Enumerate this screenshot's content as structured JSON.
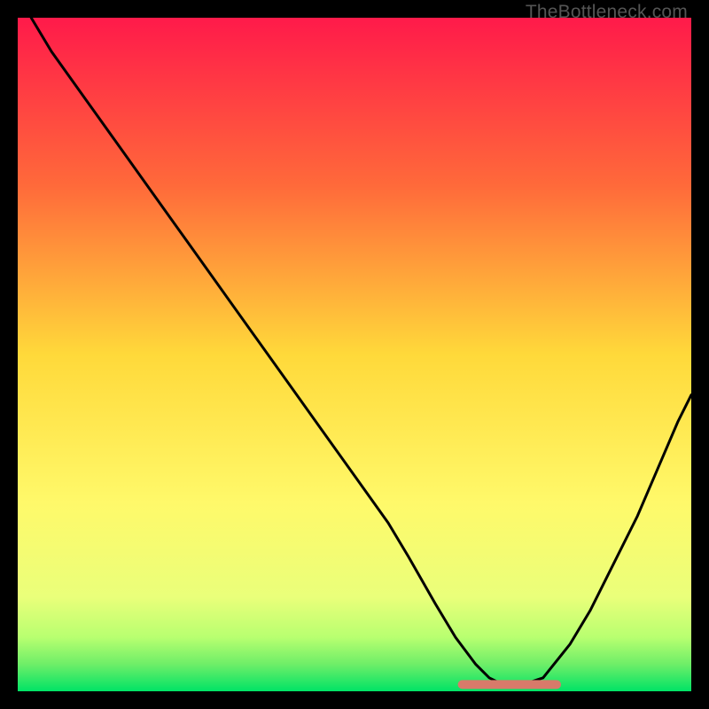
{
  "watermark": "TheBottleneck.com",
  "colors": {
    "gradient_top": "#ff1a4a",
    "gradient_mid_upper": "#ff7a3a",
    "gradient_mid": "#ffd93a",
    "gradient_lower": "#fff96a",
    "gradient_near_bottom": "#c8ff6a",
    "gradient_bottom": "#00e366",
    "curve": "#000000",
    "accent_segment": "#d87a6a",
    "frame": "#000000"
  },
  "chart_data": {
    "type": "line",
    "title": "",
    "xlabel": "",
    "ylabel": "",
    "xlim": [
      0,
      100
    ],
    "ylim": [
      0,
      100
    ],
    "series": [
      {
        "name": "bottleneck-curve",
        "x": [
          2,
          5,
          10,
          15,
          20,
          25,
          30,
          35,
          40,
          45,
          50,
          55,
          58,
          62,
          65,
          68,
          70,
          72,
          75,
          78,
          82,
          85,
          88,
          92,
          95,
          98,
          100
        ],
        "values": [
          100,
          95,
          88,
          81,
          74,
          67,
          60,
          53,
          46,
          39,
          32,
          25,
          20,
          13,
          8,
          4,
          2,
          1,
          1,
          2,
          7,
          12,
          18,
          26,
          33,
          40,
          44
        ]
      }
    ],
    "accent_segment": {
      "name": "optimal-band",
      "x_start": 66,
      "x_end": 80,
      "y": 1
    },
    "gradient_stops": [
      {
        "pos": 0.0,
        "color": "#ff1a4a"
      },
      {
        "pos": 0.25,
        "color": "#ff6a3a"
      },
      {
        "pos": 0.5,
        "color": "#ffd93a"
      },
      {
        "pos": 0.72,
        "color": "#fff96a"
      },
      {
        "pos": 0.86,
        "color": "#eaff7a"
      },
      {
        "pos": 0.92,
        "color": "#b8ff70"
      },
      {
        "pos": 0.96,
        "color": "#6eee68"
      },
      {
        "pos": 1.0,
        "color": "#00e366"
      }
    ]
  }
}
